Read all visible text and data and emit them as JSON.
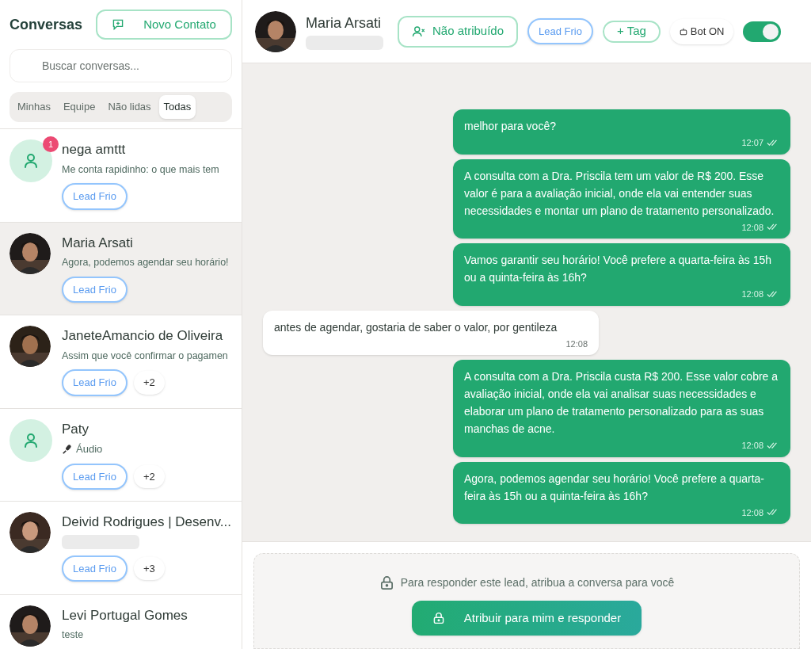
{
  "sidebar": {
    "title": "Conversas",
    "new_contact_button": "Novo Contato",
    "search": {
      "placeholder": "Buscar conversas..."
    },
    "filters": [
      {
        "label": "Minhas",
        "selected": false
      },
      {
        "label": "Equipe",
        "selected": false
      },
      {
        "label": "Não lidas",
        "selected": false
      },
      {
        "label": "Todas",
        "selected": true
      }
    ],
    "conversations": [
      {
        "name": "nega amttt",
        "avatar": {
          "kind": "default"
        },
        "unread": "1",
        "preview": {
          "kind": "text",
          "text": "Me conta rapidinho: o que mais tem"
        },
        "tags": [
          "Lead Frio"
        ],
        "selected": false
      },
      {
        "name": "Maria Arsati",
        "preview": {
          "kind": "text",
          "text": "Agora, podemos agendar seu horário!"
        },
        "tags": [
          "Lead Frio"
        ],
        "selected": true
      },
      {
        "name": "JaneteAmancio de Oliveira",
        "preview": {
          "kind": "text",
          "text": "Assim que você confirmar o pagamen"
        },
        "tags": [
          "Lead Frio"
        ],
        "more": "+2",
        "selected": false
      },
      {
        "name": "Paty",
        "avatar": {
          "kind": "default"
        },
        "preview": {
          "kind": "audio",
          "text": "Áudio"
        },
        "tags": [
          "Lead Frio"
        ],
        "more": "+2",
        "selected": false
      },
      {
        "name": "Deivid Rodrigues | Desenv...",
        "preview": {
          "kind": "redacted"
        },
        "tags": [
          "Lead Frio"
        ],
        "more": "+3",
        "selected": false
      },
      {
        "name": "Levi Portugal Gomes",
        "preview": {
          "kind": "text",
          "text": "teste"
        },
        "selected": false
      }
    ]
  },
  "chat_header": {
    "name": "Maria Arsati",
    "assign_button": "Não atribuído",
    "tag": "Lead Frio",
    "add_tag_button": "+ Tag",
    "bot_label": "Bot ON",
    "bot_on": true
  },
  "messages": [
    {
      "kind": "sent",
      "text": "melhor para você?",
      "time": "12:07"
    },
    {
      "kind": "sent",
      "text": "A consulta com a Dra. Priscila tem um valor de R$ 200. Esse valor é para a avaliação inicial, onde ela vai entender suas necessidades e montar um plano de tratamento personalizado.",
      "time": "12:08"
    },
    {
      "kind": "sent",
      "text": "Vamos garantir seu horário! Você prefere a quarta-feira às 15h ou a quinta-feira às 16h?",
      "time": "12:08"
    },
    {
      "kind": "received",
      "text": "antes de agendar, gostaria de saber o valor, por gentileza",
      "time": "12:08"
    },
    {
      "kind": "sent",
      "text": "A consulta com a Dra. Priscila custa R$ 200. Esse valor cobre a avaliação inicial, onde ela vai analisar suas necessidades e elaborar um plano de tratamento personalizado para as suas manchas de acne.",
      "time": "12:08"
    },
    {
      "kind": "sent",
      "text": "Agora, podemos agendar seu horário! Você prefere a quarta-feira às 15h ou a quinta-feira às 16h?",
      "time": "12:08"
    }
  ],
  "composer": {
    "notice": "Para responder este lead, atribua a conversa para você",
    "assign_button": "Atribuir para mim e responder"
  }
}
